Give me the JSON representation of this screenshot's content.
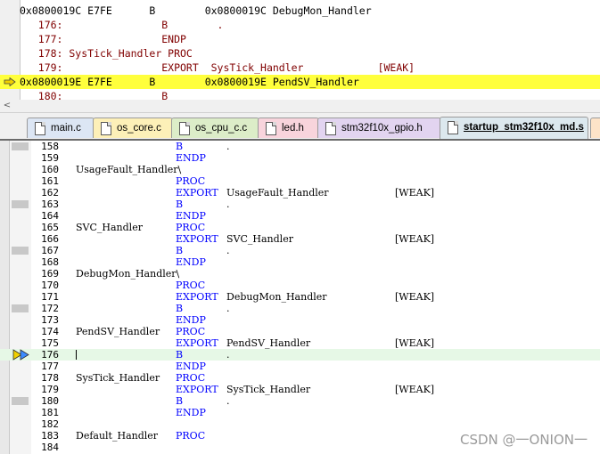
{
  "colors": {
    "current_line_disasm": "#ffff3c",
    "current_line_editor": "#e6f8e6",
    "keyword_blue": "#0000ff",
    "source_line_maroon": "#800000",
    "pc_arrow": "#f0d000"
  },
  "disassembly": {
    "lines": [
      {
        "text": "0x0800019C E7FE      B        0x0800019C DebugMon_Handler",
        "kind": "addr"
      },
      {
        "text": "   176:                B        .",
        "kind": "src"
      },
      {
        "text": "   177:                ENDP",
        "kind": "src"
      },
      {
        "text": "   178: SysTick_Handler PROC",
        "kind": "src"
      },
      {
        "text": "   179:                EXPORT  SysTick_Handler            [WEAK]",
        "kind": "src"
      },
      {
        "text": "0x0800019E E7FE      B        0x0800019E PendSV_Handler",
        "kind": "current"
      },
      {
        "text": "   180:                B",
        "kind": "src"
      }
    ]
  },
  "scrollbar": {
    "left_arrow": "<"
  },
  "tabs": [
    {
      "label": "main.c",
      "bg": "#dce6f4"
    },
    {
      "label": "os_core.c",
      "bg": "#fdf0b8"
    },
    {
      "label": "os_cpu_c.c",
      "bg": "#dcedc8"
    },
    {
      "label": "led.h",
      "bg": "#f8d4dc"
    },
    {
      "label": "stm32f10x_gpio.h",
      "bg": "#e2d4f0"
    },
    {
      "label": "startup_stm32f10x_md.s",
      "bg": "#dce8ee",
      "active": true
    }
  ],
  "editor": {
    "lines": [
      {
        "num": "158",
        "label": "",
        "op": "B",
        "arg": ".",
        "attr": "",
        "bp": true
      },
      {
        "num": "159",
        "label": "",
        "op": "ENDP",
        "arg": "",
        "attr": "",
        "bp": false
      },
      {
        "num": "160",
        "label": "UsageFault_Handler\\",
        "op": "",
        "arg": "",
        "attr": "",
        "bp": false
      },
      {
        "num": "161",
        "label": "",
        "op": "PROC",
        "arg": "",
        "attr": "",
        "bp": false
      },
      {
        "num": "162",
        "label": "",
        "op": "EXPORT",
        "arg": "UsageFault_Handler",
        "attr": "[WEAK]",
        "bp": false
      },
      {
        "num": "163",
        "label": "",
        "op": "B",
        "arg": ".",
        "attr": "",
        "bp": true
      },
      {
        "num": "164",
        "label": "",
        "op": "ENDP",
        "arg": "",
        "attr": "",
        "bp": false
      },
      {
        "num": "165",
        "label": "SVC_Handler",
        "op": "PROC",
        "arg": "",
        "attr": "",
        "bp": false
      },
      {
        "num": "166",
        "label": "",
        "op": "EXPORT",
        "arg": "SVC_Handler",
        "attr": "[WEAK]",
        "bp": false
      },
      {
        "num": "167",
        "label": "",
        "op": "B",
        "arg": ".",
        "attr": "",
        "bp": true
      },
      {
        "num": "168",
        "label": "",
        "op": "ENDP",
        "arg": "",
        "attr": "",
        "bp": false
      },
      {
        "num": "169",
        "label": "DebugMon_Handler\\",
        "op": "",
        "arg": "",
        "attr": "",
        "bp": false
      },
      {
        "num": "170",
        "label": "",
        "op": "PROC",
        "arg": "",
        "attr": "",
        "bp": false
      },
      {
        "num": "171",
        "label": "",
        "op": "EXPORT",
        "arg": "DebugMon_Handler",
        "attr": "[WEAK]",
        "bp": false
      },
      {
        "num": "172",
        "label": "",
        "op": "B",
        "arg": ".",
        "attr": "",
        "bp": true
      },
      {
        "num": "173",
        "label": "",
        "op": "ENDP",
        "arg": "",
        "attr": "",
        "bp": false
      },
      {
        "num": "174",
        "label": "PendSV_Handler",
        "op": "PROC",
        "arg": "",
        "attr": "",
        "bp": false
      },
      {
        "num": "175",
        "label": "",
        "op": "EXPORT",
        "arg": "PendSV_Handler",
        "attr": "[WEAK]",
        "bp": false
      },
      {
        "num": "176",
        "label": "",
        "op": "B",
        "arg": ".",
        "attr": "",
        "bp": false,
        "current": true
      },
      {
        "num": "177",
        "label": "",
        "op": "ENDP",
        "arg": "",
        "attr": "",
        "bp": false
      },
      {
        "num": "178",
        "label": "SysTick_Handler",
        "op": "PROC",
        "arg": "",
        "attr": "",
        "bp": false
      },
      {
        "num": "179",
        "label": "",
        "op": "EXPORT",
        "arg": "SysTick_Handler",
        "attr": "[WEAK]",
        "bp": false
      },
      {
        "num": "180",
        "label": "",
        "op": "B",
        "arg": ".",
        "attr": "",
        "bp": true
      },
      {
        "num": "181",
        "label": "",
        "op": "ENDP",
        "arg": "",
        "attr": "",
        "bp": false
      },
      {
        "num": "182",
        "label": "",
        "op": "",
        "arg": "",
        "attr": "",
        "bp": false
      },
      {
        "num": "183",
        "label": "Default_Handler",
        "op": "PROC",
        "arg": "",
        "attr": "",
        "bp": false
      },
      {
        "num": "184",
        "label": "",
        "op": "",
        "arg": "",
        "attr": "",
        "bp": false
      }
    ]
  },
  "watermark": "CSDN @一ONION一"
}
